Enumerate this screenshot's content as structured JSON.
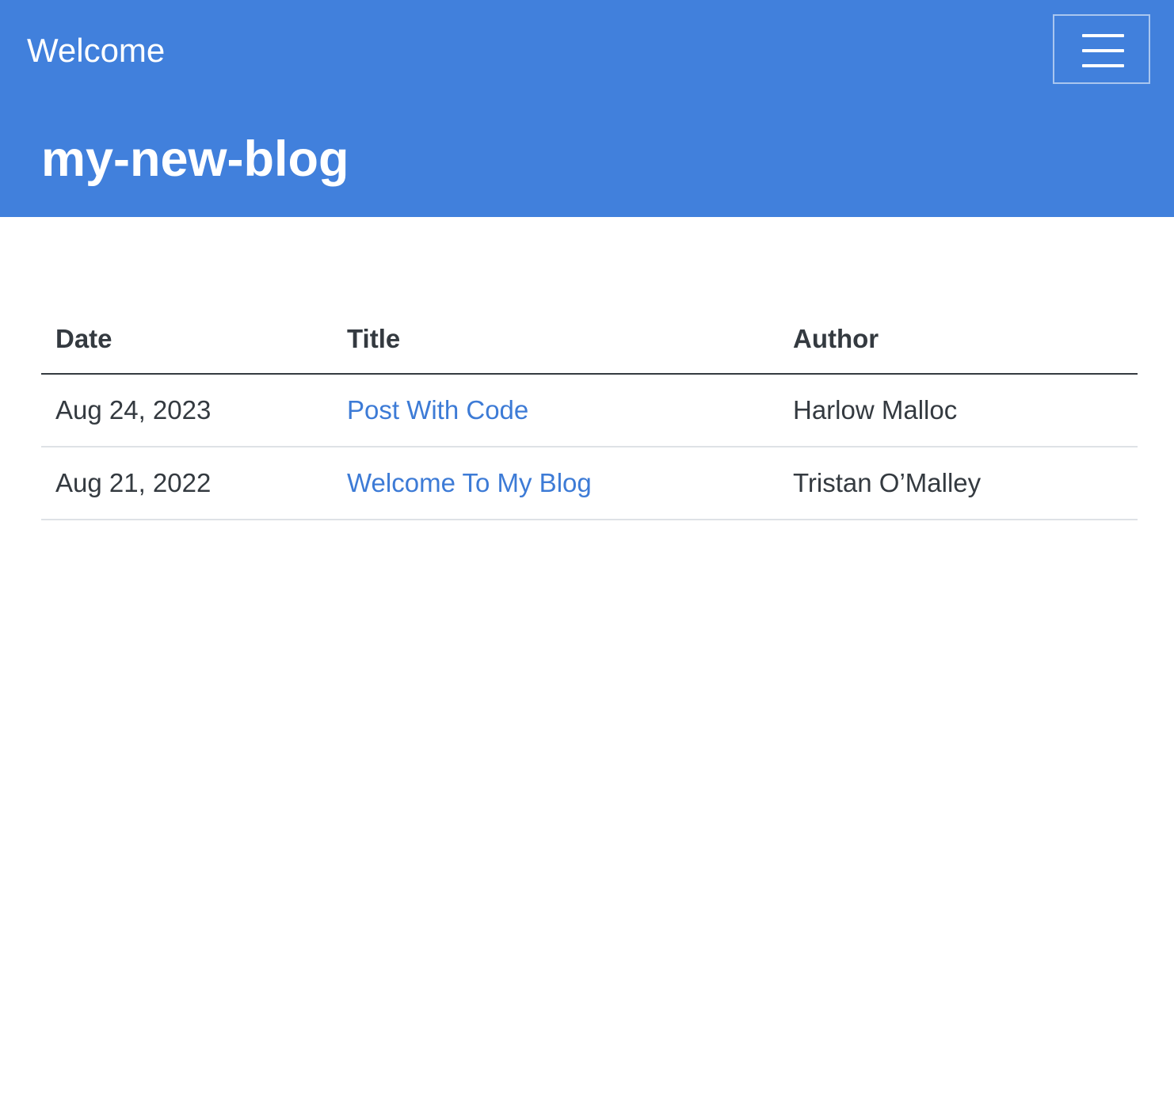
{
  "navbar": {
    "brand": "Welcome",
    "menu_icon": "hamburger-menu-icon",
    "background_color": "#4180dc"
  },
  "header": {
    "title": "my-new-blog"
  },
  "listing": {
    "columns": [
      "Date",
      "Title",
      "Author"
    ],
    "rows": [
      {
        "date": "Aug 24, 2023",
        "title": "Post With Code",
        "author": "Harlow Malloc"
      },
      {
        "date": "Aug 21, 2022",
        "title": "Welcome To My Blog",
        "author": "Tristan O’Malley"
      }
    ]
  },
  "colors": {
    "link": "#3d7bd6",
    "text": "#343a40"
  }
}
